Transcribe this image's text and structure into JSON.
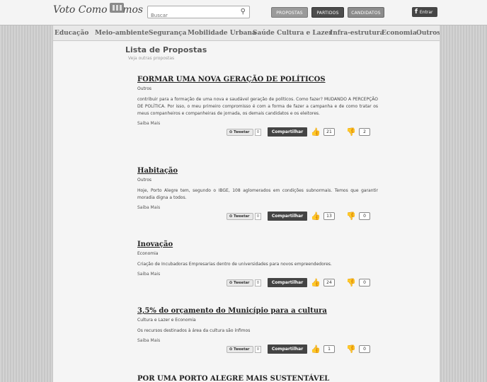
{
  "header": {
    "logo_text": "Voto Como Vamos",
    "search_placeholder": "Buscar",
    "nav": {
      "propostas": "PROPOSTAS",
      "partidos": "PARTIDOS",
      "candidatos": "CANDIDATOS"
    },
    "login_label": "Entrar"
  },
  "categories": [
    "Educação",
    "Meio-ambiente",
    "Segurança",
    "Mobilidade Urbana",
    "Saúde",
    "Cultura e Lazer",
    "Infra-estrutura",
    "Economia",
    "Outros"
  ],
  "page": {
    "title": "Lista de Propostas",
    "subtitle": "Veja outras propostas"
  },
  "actions": {
    "tweet_label": "Tweetar",
    "share_label": "Compartilhar",
    "more_label": "Saiba Mais"
  },
  "proposals": [
    {
      "title": "FORMAR UMA NOVA GERAÇÃO DE POLÍTICOS",
      "category": "Outros",
      "description": "contribuir para a formação de uma nova e saudável geração de políticos. Como fazer? MUDANDO A PERCEPÇÃO DE POLÍTICA. Por isso, o meu primeiro compromisso é com a forma de fazer a campanha e de como tratar os meus companheiros e companheiras de jornada, os demais candidatos e os eleitores.",
      "tweets": "0",
      "up": "21",
      "down": "2"
    },
    {
      "title": "Habitação",
      "category": "Outros",
      "description": "Hoje, Porto Alegre tem, segundo o IBGE, 108 aglomerados em condições subnormais. Temos que garantir moradia digna a todos.",
      "tweets": "0",
      "up": "13",
      "down": "0"
    },
    {
      "title": "Inovação",
      "category": "Economia",
      "description": "Criação de Incubadoras Empresarias dentro de universidades para novos empreendedores.",
      "tweets": "0",
      "up": "24",
      "down": "0"
    },
    {
      "title": "3,5% do orçamento do Município para a cultura",
      "category": "Cultura e Lazer e Economia",
      "description": "Os recursos destinados à área da cultura são ínfimos",
      "tweets": "0",
      "up": "1",
      "down": "0"
    },
    {
      "title": "POR UMA PORTO ALEGRE MAIS SUSTENTÁVEL"
    }
  ]
}
